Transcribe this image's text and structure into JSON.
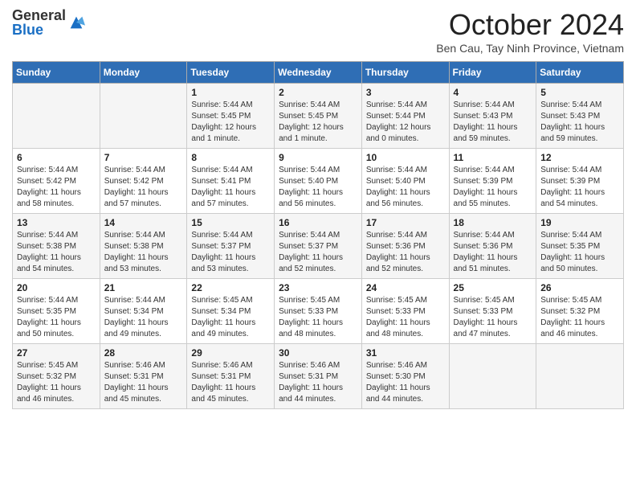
{
  "logo": {
    "general": "General",
    "blue": "Blue"
  },
  "title": "October 2024",
  "subtitle": "Ben Cau, Tay Ninh Province, Vietnam",
  "days_of_week": [
    "Sunday",
    "Monday",
    "Tuesday",
    "Wednesday",
    "Thursday",
    "Friday",
    "Saturday"
  ],
  "weeks": [
    [
      {
        "day": "",
        "content": ""
      },
      {
        "day": "",
        "content": ""
      },
      {
        "day": "1",
        "content": "Sunrise: 5:44 AM\nSunset: 5:45 PM\nDaylight: 12 hours and 1 minute."
      },
      {
        "day": "2",
        "content": "Sunrise: 5:44 AM\nSunset: 5:45 PM\nDaylight: 12 hours and 1 minute."
      },
      {
        "day": "3",
        "content": "Sunrise: 5:44 AM\nSunset: 5:44 PM\nDaylight: 12 hours and 0 minutes."
      },
      {
        "day": "4",
        "content": "Sunrise: 5:44 AM\nSunset: 5:43 PM\nDaylight: 11 hours and 59 minutes."
      },
      {
        "day": "5",
        "content": "Sunrise: 5:44 AM\nSunset: 5:43 PM\nDaylight: 11 hours and 59 minutes."
      }
    ],
    [
      {
        "day": "6",
        "content": "Sunrise: 5:44 AM\nSunset: 5:42 PM\nDaylight: 11 hours and 58 minutes."
      },
      {
        "day": "7",
        "content": "Sunrise: 5:44 AM\nSunset: 5:42 PM\nDaylight: 11 hours and 57 minutes."
      },
      {
        "day": "8",
        "content": "Sunrise: 5:44 AM\nSunset: 5:41 PM\nDaylight: 11 hours and 57 minutes."
      },
      {
        "day": "9",
        "content": "Sunrise: 5:44 AM\nSunset: 5:40 PM\nDaylight: 11 hours and 56 minutes."
      },
      {
        "day": "10",
        "content": "Sunrise: 5:44 AM\nSunset: 5:40 PM\nDaylight: 11 hours and 56 minutes."
      },
      {
        "day": "11",
        "content": "Sunrise: 5:44 AM\nSunset: 5:39 PM\nDaylight: 11 hours and 55 minutes."
      },
      {
        "day": "12",
        "content": "Sunrise: 5:44 AM\nSunset: 5:39 PM\nDaylight: 11 hours and 54 minutes."
      }
    ],
    [
      {
        "day": "13",
        "content": "Sunrise: 5:44 AM\nSunset: 5:38 PM\nDaylight: 11 hours and 54 minutes."
      },
      {
        "day": "14",
        "content": "Sunrise: 5:44 AM\nSunset: 5:38 PM\nDaylight: 11 hours and 53 minutes."
      },
      {
        "day": "15",
        "content": "Sunrise: 5:44 AM\nSunset: 5:37 PM\nDaylight: 11 hours and 53 minutes."
      },
      {
        "day": "16",
        "content": "Sunrise: 5:44 AM\nSunset: 5:37 PM\nDaylight: 11 hours and 52 minutes."
      },
      {
        "day": "17",
        "content": "Sunrise: 5:44 AM\nSunset: 5:36 PM\nDaylight: 11 hours and 52 minutes."
      },
      {
        "day": "18",
        "content": "Sunrise: 5:44 AM\nSunset: 5:36 PM\nDaylight: 11 hours and 51 minutes."
      },
      {
        "day": "19",
        "content": "Sunrise: 5:44 AM\nSunset: 5:35 PM\nDaylight: 11 hours and 50 minutes."
      }
    ],
    [
      {
        "day": "20",
        "content": "Sunrise: 5:44 AM\nSunset: 5:35 PM\nDaylight: 11 hours and 50 minutes."
      },
      {
        "day": "21",
        "content": "Sunrise: 5:44 AM\nSunset: 5:34 PM\nDaylight: 11 hours and 49 minutes."
      },
      {
        "day": "22",
        "content": "Sunrise: 5:45 AM\nSunset: 5:34 PM\nDaylight: 11 hours and 49 minutes."
      },
      {
        "day": "23",
        "content": "Sunrise: 5:45 AM\nSunset: 5:33 PM\nDaylight: 11 hours and 48 minutes."
      },
      {
        "day": "24",
        "content": "Sunrise: 5:45 AM\nSunset: 5:33 PM\nDaylight: 11 hours and 48 minutes."
      },
      {
        "day": "25",
        "content": "Sunrise: 5:45 AM\nSunset: 5:33 PM\nDaylight: 11 hours and 47 minutes."
      },
      {
        "day": "26",
        "content": "Sunrise: 5:45 AM\nSunset: 5:32 PM\nDaylight: 11 hours and 46 minutes."
      }
    ],
    [
      {
        "day": "27",
        "content": "Sunrise: 5:45 AM\nSunset: 5:32 PM\nDaylight: 11 hours and 46 minutes."
      },
      {
        "day": "28",
        "content": "Sunrise: 5:46 AM\nSunset: 5:31 PM\nDaylight: 11 hours and 45 minutes."
      },
      {
        "day": "29",
        "content": "Sunrise: 5:46 AM\nSunset: 5:31 PM\nDaylight: 11 hours and 45 minutes."
      },
      {
        "day": "30",
        "content": "Sunrise: 5:46 AM\nSunset: 5:31 PM\nDaylight: 11 hours and 44 minutes."
      },
      {
        "day": "31",
        "content": "Sunrise: 5:46 AM\nSunset: 5:30 PM\nDaylight: 11 hours and 44 minutes."
      },
      {
        "day": "",
        "content": ""
      },
      {
        "day": "",
        "content": ""
      }
    ]
  ]
}
